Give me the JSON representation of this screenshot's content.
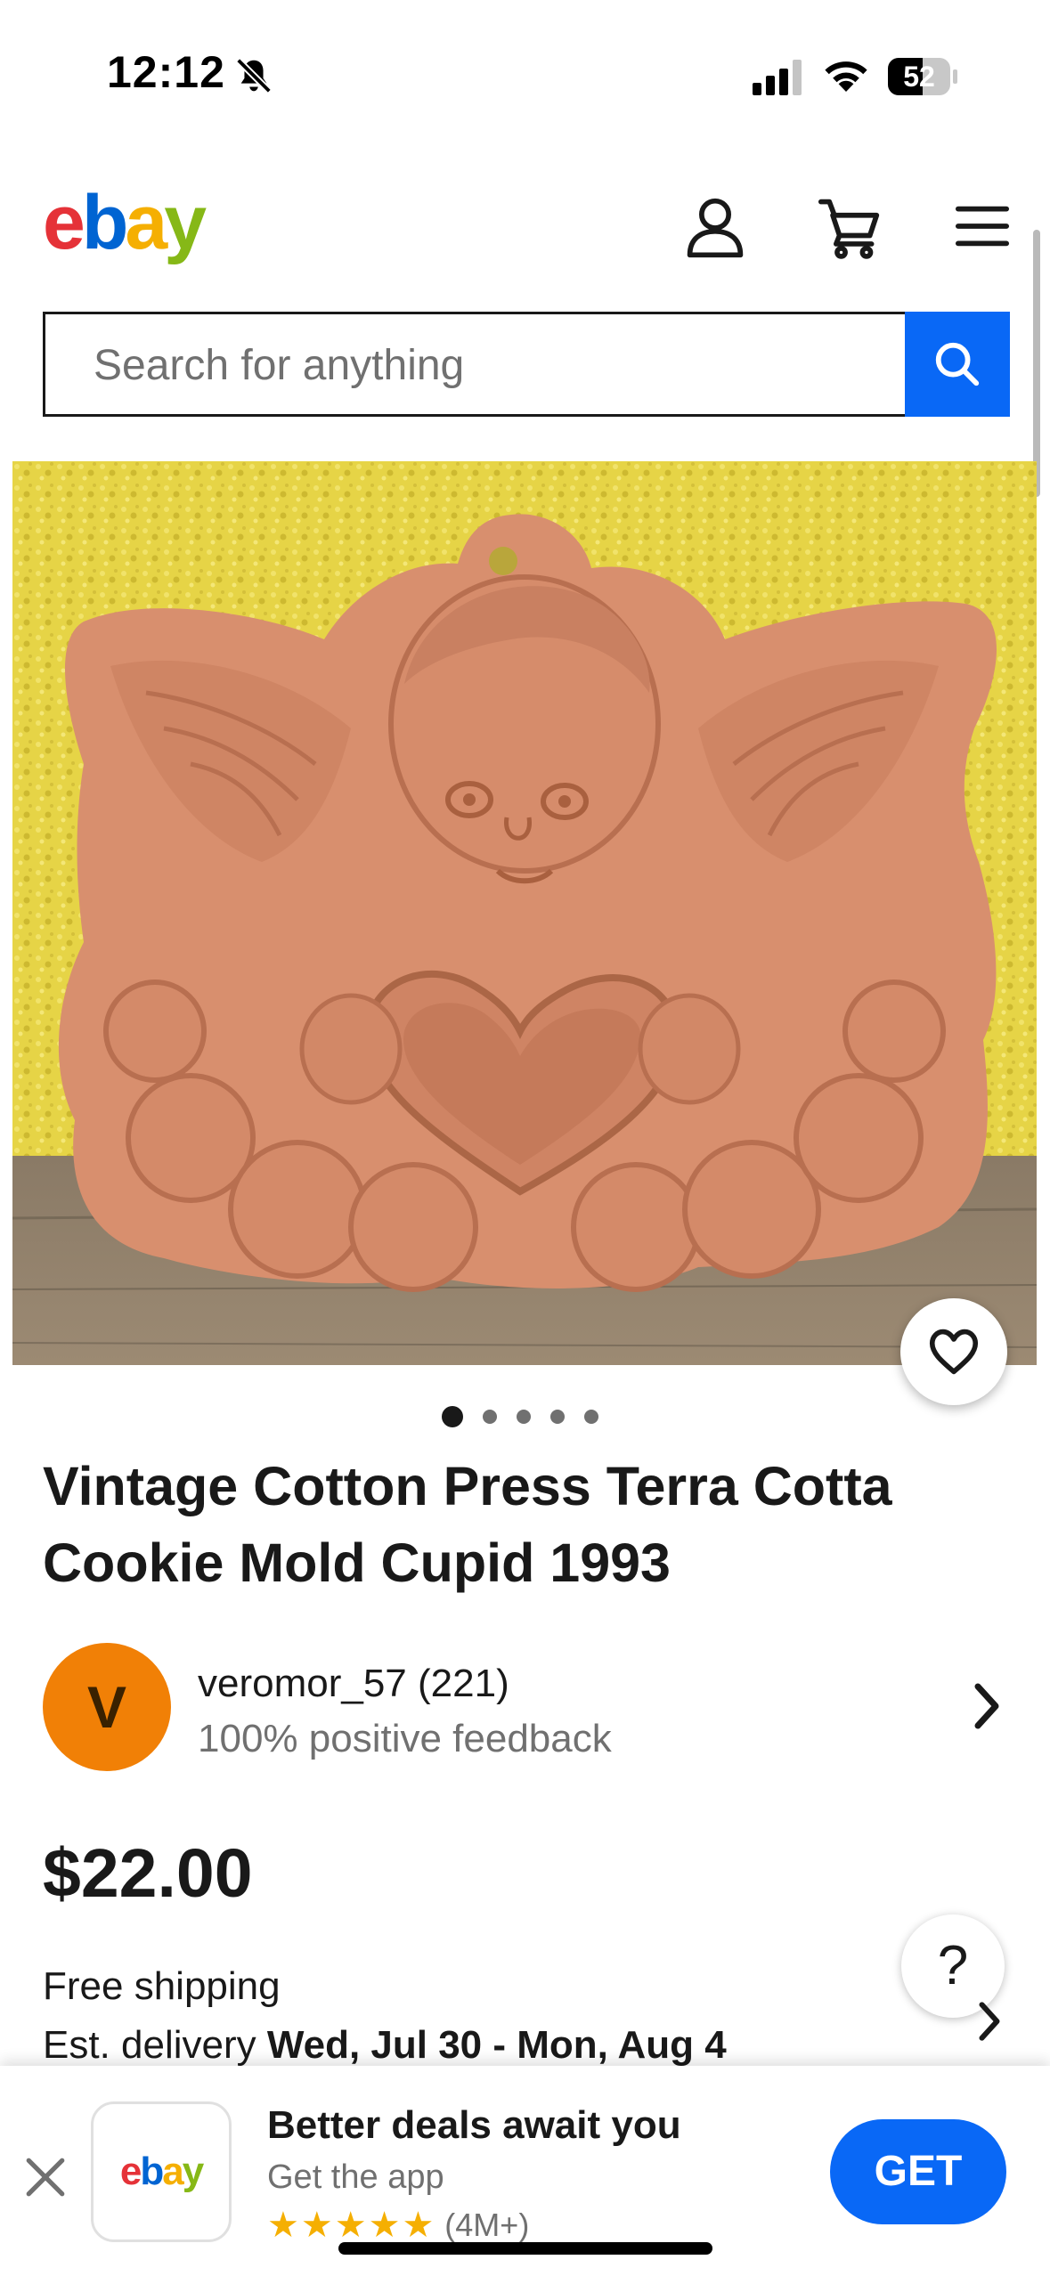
{
  "status_bar": {
    "time": "12:12",
    "battery": "52"
  },
  "header": {
    "logo": {
      "e": "e",
      "b": "b",
      "a": "a",
      "y": "y"
    },
    "icons": [
      "account-icon",
      "cart-icon",
      "menu-icon"
    ]
  },
  "search": {
    "placeholder": "Search for anything"
  },
  "gallery": {
    "image_count": 5,
    "current_index": 1
  },
  "item": {
    "title": "Vintage Cotton Press Terra Cotta Cookie Mold Cupid 1993",
    "price": "$22.00"
  },
  "seller": {
    "avatar_letter": "V",
    "name_with_score": "veromor_57 (221)",
    "feedback": "100% positive feedback"
  },
  "shipping": {
    "label": "Free shipping",
    "delivery_prefix": "Est. delivery ",
    "delivery_dates": "Wed, Jul 30 - Mon, Aug 4"
  },
  "help": {
    "label": "?"
  },
  "app_banner": {
    "title": "Better deals await you",
    "subtitle": "Get the app",
    "stars": "★★★★★",
    "review_count": "(4M+)",
    "get_label": "GET"
  },
  "colors": {
    "accent_blue": "#0968f6",
    "avatar_orange": "#f18006",
    "terracotta": "#d69071",
    "wall_yellow": "#e8d649",
    "star_gold": "#f5af02"
  }
}
